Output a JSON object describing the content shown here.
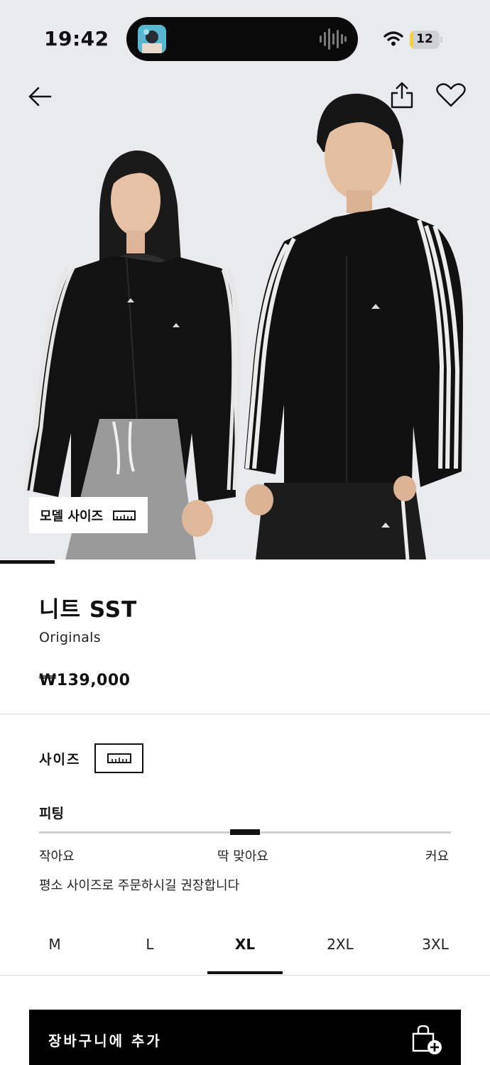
{
  "status_bar": {
    "time": "19:42",
    "battery_level": "12",
    "battery_fraction": 0.12
  },
  "nav": {
    "back_icon": "arrow-left-icon",
    "share_icon": "share-icon",
    "wishlist_icon": "heart-outline-icon"
  },
  "gallery": {
    "model_size_label": "모델 사이즈",
    "model_size_icon": "ruler-icon",
    "image_count": 9,
    "image_index": 1
  },
  "product": {
    "title": "니트 SST",
    "brand": "Originals",
    "price": "₩139,000"
  },
  "size_section": {
    "label": "사이즈",
    "guide_icon": "ruler-icon",
    "fit_label": "피팅",
    "fit_position": 0.5,
    "fit_low": "작아요",
    "fit_mid": "딱 맞아요",
    "fit_high": "커요",
    "fit_note": "평소 사이즈로 주문하시길 권장합니다",
    "options": [
      "M",
      "L",
      "XL",
      "2XL",
      "3XL"
    ],
    "selected": "XL"
  },
  "cart": {
    "label": "장바구니에 추가",
    "icon": "shopping-bag-plus-icon"
  },
  "colors": {
    "background": "#e8eaed",
    "primary": "#000000",
    "battery_fill": "#f4d03f"
  }
}
